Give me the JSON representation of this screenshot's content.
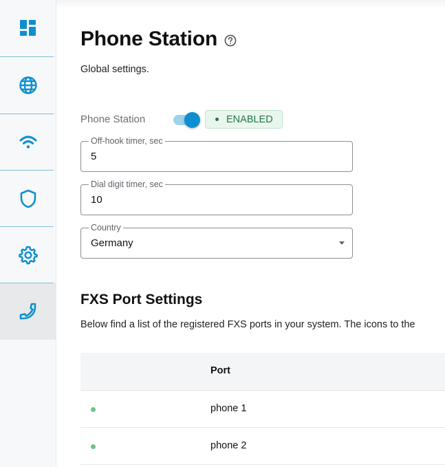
{
  "sidebar": {
    "items": [
      {
        "icon": "dashboard-icon",
        "active": false
      },
      {
        "icon": "globe-icon",
        "active": false
      },
      {
        "icon": "wifi-icon",
        "active": false
      },
      {
        "icon": "shield-icon",
        "active": false
      },
      {
        "icon": "gear-icon",
        "active": false
      },
      {
        "icon": "phone-icon",
        "active": true
      }
    ],
    "accent_color": "#0e8fd0"
  },
  "page": {
    "title": "Phone Station",
    "help_icon": "help-circle-icon",
    "subtitle": "Global settings."
  },
  "phone_station": {
    "label": "Phone Station",
    "enabled": true,
    "status_text": "ENABLED",
    "status_color": "#237544"
  },
  "fields": {
    "off_hook_timer": {
      "label": "Off-hook timer, sec",
      "value": "5"
    },
    "dial_digit_timer": {
      "label": "Dial digit timer, sec",
      "value": "10"
    },
    "country": {
      "label": "Country",
      "value": "Germany"
    }
  },
  "fxs": {
    "title": "FXS Port Settings",
    "description": "Below find a list of the registered FXS ports in your system. The icons to the",
    "table": {
      "columns": [
        "Port"
      ],
      "rows": [
        {
          "status": "active",
          "port": "phone 1"
        },
        {
          "status": "active",
          "port": "phone 2"
        }
      ]
    }
  }
}
